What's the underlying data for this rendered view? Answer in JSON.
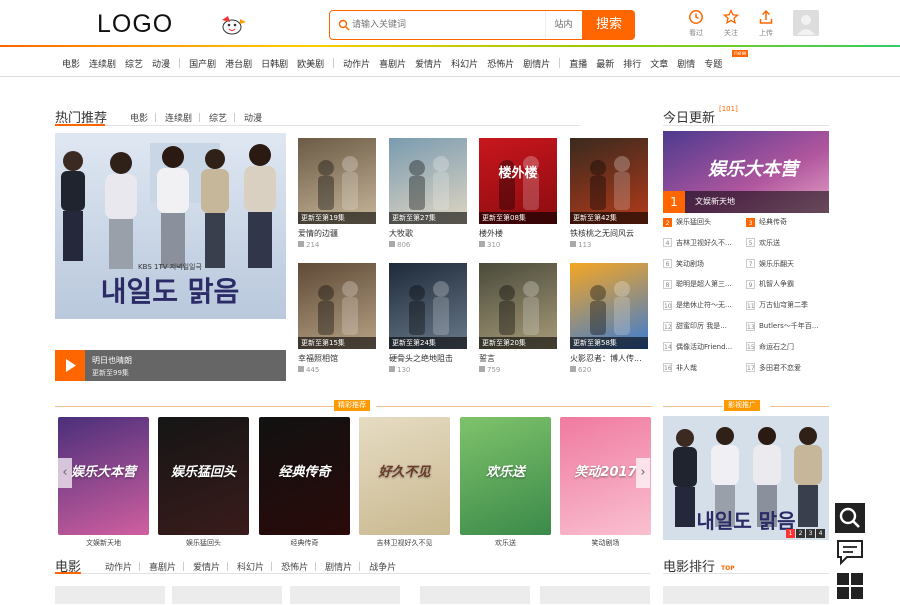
{
  "header": {
    "logo": "LOGO",
    "search_placeholder": "请输入关键词",
    "search_scope": "站内",
    "search_button": "搜索",
    "tools": [
      {
        "icon": "history-icon",
        "label": "看过"
      },
      {
        "icon": "star-icon",
        "label": "关注"
      },
      {
        "icon": "upload-icon",
        "label": "上传"
      }
    ]
  },
  "nav": {
    "groups": [
      [
        "电影",
        "连续剧",
        "综艺",
        "动漫"
      ],
      [
        "国产剧",
        "港台剧",
        "日韩剧",
        "欧美剧"
      ],
      [
        "动作片",
        "喜剧片",
        "爱情片",
        "科幻片",
        "恐怖片",
        "剧情片"
      ],
      [
        "直播",
        "最新",
        "排行",
        "文章",
        "剧情",
        "专题"
      ]
    ],
    "hot_tag": "new"
  },
  "hot": {
    "title": "热门推荐",
    "tabs": [
      "电影",
      "连续剧",
      "综艺",
      "动漫"
    ],
    "feature_title": "明日也晴朗",
    "feature_ep": "更新至99集",
    "feature_poster_text": "내일도 맑음",
    "feature_poster_small": "KBS 1TV 저녁일일극",
    "cards": [
      {
        "title": "爱情的边疆",
        "ep": "更新至第19集",
        "views": "214",
        "colors": [
          "#6b5a45",
          "#c8b79a"
        ]
      },
      {
        "title": "大牧歌",
        "ep": "更新至第27集",
        "views": "806",
        "colors": [
          "#7a9bb0",
          "#e0d6c2"
        ]
      },
      {
        "title": "楼外楼",
        "ep": "更新至第08集",
        "views": "310",
        "colors": [
          "#c8161d",
          "#8a0c10"
        ],
        "poster_text": "楼外楼"
      },
      {
        "title": "铁核桃之无间风云",
        "ep": "更新至第42集",
        "views": "113",
        "colors": [
          "#3a2a1e",
          "#b53a1a"
        ]
      },
      {
        "title": "幸福照相馆",
        "ep": "更新至第15集",
        "views": "445",
        "colors": [
          "#5e4a36",
          "#b8a386"
        ]
      },
      {
        "title": "硬骨头之绝地阻击",
        "ep": "更新至第24集",
        "views": "130",
        "colors": [
          "#1e2a3a",
          "#6a7a8a"
        ]
      },
      {
        "title": "誓言",
        "ep": "更新至第20集",
        "views": "759",
        "colors": [
          "#4a4a3a",
          "#a89c7a"
        ]
      },
      {
        "title": "火影忍者：博人传...",
        "ep": "更新至第58集",
        "views": "620",
        "colors": [
          "#f5a623",
          "#3a7bd5"
        ]
      }
    ]
  },
  "today": {
    "title": "今日更新",
    "count": "[101]",
    "feature_text": "娱乐大本营",
    "feature_num": "1",
    "feature_name": "文娱新天地",
    "items": [
      {
        "n": "2",
        "text": "娱乐猛回头"
      },
      {
        "n": "3",
        "text": "经典传奇"
      },
      {
        "n": "4",
        "text": "吉林卫视好久不..."
      },
      {
        "n": "5",
        "text": "欢乐送"
      },
      {
        "n": "6",
        "text": "笑动剧场"
      },
      {
        "n": "7",
        "text": "娱乐乐翻天"
      },
      {
        "n": "8",
        "text": "聪明是超人第三..."
      },
      {
        "n": "9",
        "text": "机智人争霸"
      },
      {
        "n": "10",
        "text": "是绝休止符～无..."
      },
      {
        "n": "11",
        "text": "万古仙穹第二季"
      },
      {
        "n": "12",
        "text": "甜蜜印厉 我是..."
      },
      {
        "n": "13",
        "text": "Butlers～千年百..."
      },
      {
        "n": "14",
        "text": "偶像活动Friend..."
      },
      {
        "n": "15",
        "text": "命运石之门"
      },
      {
        "n": "16",
        "text": "非人哉"
      },
      {
        "n": "17",
        "text": "多田君不恋爱"
      }
    ]
  },
  "featured": {
    "pill": "精彩推荐",
    "items": [
      {
        "label": "文娱新天地",
        "text": "娱乐大本营",
        "colors": [
          "#4a2f7a",
          "#d05fa0"
        ]
      },
      {
        "label": "娱乐猛回头",
        "text": "娱乐猛回头",
        "colors": [
          "#151515",
          "#3a1b1b"
        ]
      },
      {
        "label": "经典传奇",
        "text": "经典传奇",
        "colors": [
          "#111111",
          "#2a0a0a"
        ]
      },
      {
        "label": "吉林卫视好久不见",
        "text": "好久不见",
        "colors": [
          "#e6dcc3",
          "#c9b88f"
        ]
      },
      {
        "label": "欢乐送",
        "text": "欢乐送",
        "colors": [
          "#7fc36b",
          "#3b8a4a"
        ]
      },
      {
        "label": "笑动剧场",
        "text": "笑动2017",
        "colors": [
          "#f07aa0",
          "#f9c0d0"
        ]
      }
    ]
  },
  "films": {
    "pill": "影视推广",
    "dots": [
      "1",
      "2",
      "3",
      "4"
    ]
  },
  "movie_section": {
    "title": "电影",
    "tabs": [
      "动作片",
      "喜剧片",
      "爱情片",
      "科幻片",
      "恐怖片",
      "剧情片",
      "战争片"
    ],
    "rank_title": "电影排行",
    "rank_tag": "TOP"
  }
}
